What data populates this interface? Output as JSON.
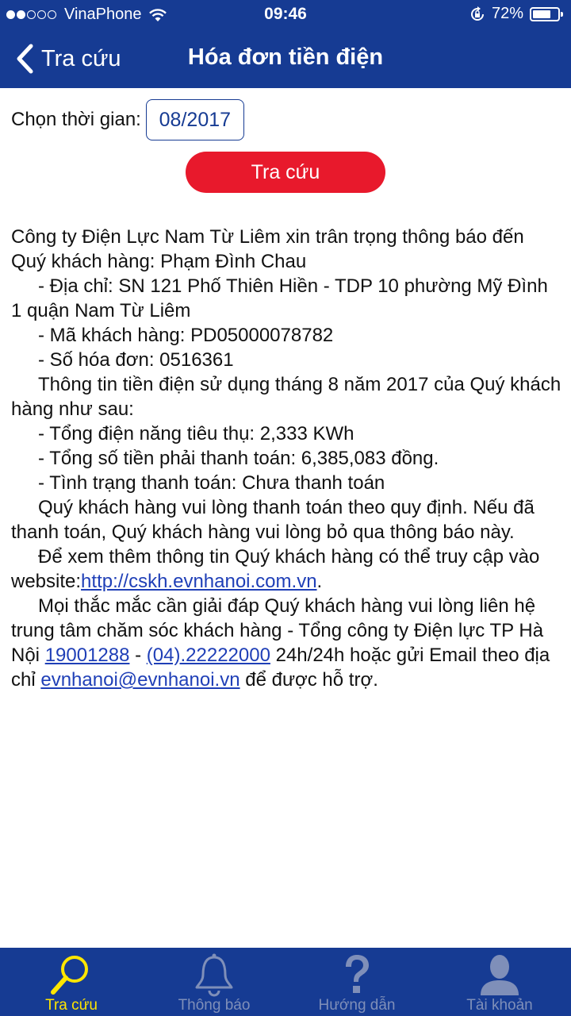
{
  "status_bar": {
    "carrier": "VinaPhone",
    "time": "09:46",
    "battery": "72%",
    "battery_level": 0.72
  },
  "nav": {
    "back_label": "Tra cứu",
    "title": "Hóa đơn tiền điện"
  },
  "filter": {
    "time_label": "Chọn thời gian:",
    "time_value": "08/2017",
    "search_button": "Tra cứu"
  },
  "notice": {
    "line1": "Công ty Điện Lực Nam Từ Liêm xin trân trọng thông báo đến Quý khách hàng: Phạm Đình Chau",
    "address": "- Địa chỉ: SN 121 Phố Thiên Hiền - TDP 10 phường Mỹ Đình 1 quận Nam Từ Liêm",
    "customer_code": "- Mã khách hàng: PD05000078782",
    "invoice_number": "- Số hóa đơn: 0516361",
    "intro": "Thông tin tiền điện sử dụng tháng 8 năm 2017 của Quý khách hàng như sau:",
    "consumption": "- Tổng điện năng tiêu thụ: 2,333 KWh",
    "amount": "- Tổng số tiền phải thanh toán: 6,385,083 đồng.",
    "payment_status": "- Tình trạng thanh toán: Chưa thanh toán",
    "reminder": "Quý khách hàng vui lòng thanh toán theo quy định. Nếu đã thanh toán, Quý khách hàng vui lòng bỏ qua thông báo này.",
    "website_prefix": "Để xem thêm thông tin Quý khách hàng có thể truy cập vào website:",
    "website_link": "http://cskh.evnhanoi.com.vn",
    "website_suffix": ".",
    "support_prefix": "Mọi thắc mắc cần giải đáp Quý khách hàng vui lòng liên hệ trung tâm chăm sóc khách hàng - Tổng công ty Điện lực TP Hà Nội ",
    "hotline1": "19001288",
    "separator": " - ",
    "hotline2": "(04).22222000",
    "support_middle": " 24h/24h hoặc gửi Email theo địa chỉ ",
    "email": "evnhanoi@evnhanoi.vn",
    "support_suffix": " để được hỗ trợ."
  },
  "tabs": [
    {
      "label": "Tra cứu",
      "icon": "search-icon",
      "active": true
    },
    {
      "label": "Thông báo",
      "icon": "bell-icon",
      "active": false
    },
    {
      "label": "Hướng dẫn",
      "icon": "question-icon",
      "active": false
    },
    {
      "label": "Tài khoản",
      "icon": "user-icon",
      "active": false
    }
  ],
  "colors": {
    "primary": "#163b93",
    "accent_red": "#e8192c",
    "active_tab": "#ffe600",
    "inactive_tab": "#7f8fb9",
    "link": "#1f3fb7"
  }
}
